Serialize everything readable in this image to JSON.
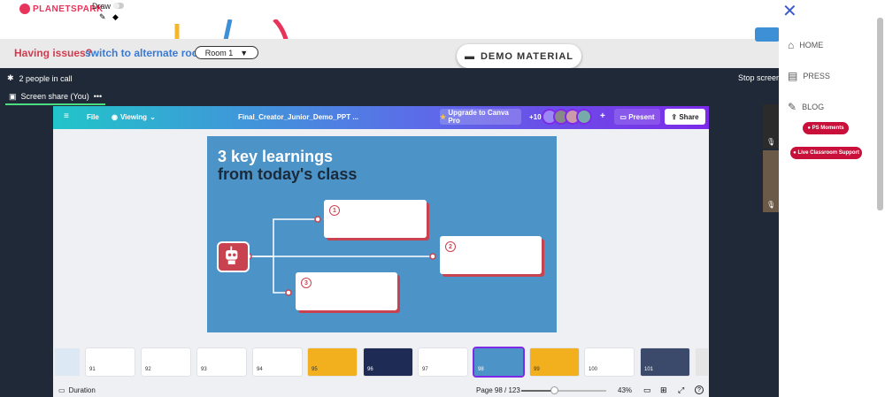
{
  "top": {
    "logo": "PLANETSPARK",
    "draw_label": "Draw"
  },
  "issues": {
    "question": "Having issues?",
    "link": "switch to alternate room",
    "room_value": "Room 1"
  },
  "demo_button": "DEMO MATERIAL",
  "call": {
    "people": "2 people in call",
    "stop": "Stop screen",
    "share_tab": "Screen share (You)"
  },
  "canva": {
    "menu": {
      "file": "File",
      "viewing": "Viewing",
      "doc_title": "Final_Creator_Junior_Demo_PPT ...",
      "upgrade": "Upgrade to Canva Pro",
      "collab_count": "+10",
      "present": "Present",
      "share": "Share"
    },
    "slide": {
      "title_line1": "3 key learnings",
      "title_line2": "from today's class",
      "n1": "1",
      "n2": "2",
      "n3": "3"
    },
    "thumbnails": [
      "91",
      "92",
      "93",
      "94",
      "95",
      "96",
      "97",
      "98",
      "99",
      "100",
      "101"
    ],
    "bottom": {
      "duration": "Duration",
      "page": "Page 98 / 123",
      "zoom": "43%",
      "zoom_level": 0.39
    }
  },
  "panel": {
    "home": "HOME",
    "press": "PRESS",
    "blog": "BLOG",
    "moments": "PS Moments",
    "support": "Live Classroom Support"
  },
  "colors": {
    "accent_red": "#c94250",
    "slide_blue": "#4c93c8",
    "canva_purple": "#7d2ae8",
    "link_blue": "#3a7ad0"
  }
}
